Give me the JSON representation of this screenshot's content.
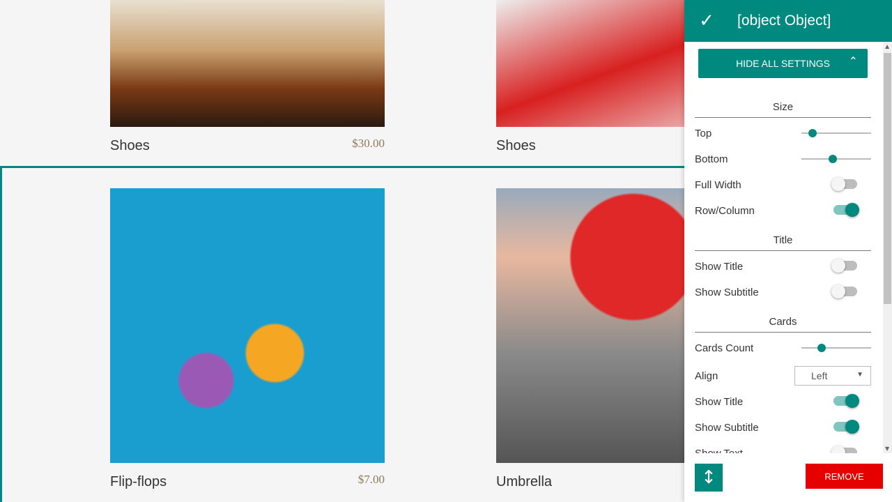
{
  "products_top": [
    {
      "title": "Shoes",
      "price": "$30.00"
    },
    {
      "title": "Shoes",
      "price": ""
    }
  ],
  "products_main": [
    {
      "title": "Flip-flops",
      "price": "$7.00"
    },
    {
      "title": "Umbrella",
      "price": ""
    }
  ],
  "panel": {
    "title": {
      "show_title_label": "Show Title",
      "show_title": false,
      "show_subtitle_label": "Show Subtitle",
      "show_subtitle": false
    },
    "hide_all": "HIDE ALL SETTINGS",
    "groups": {
      "size": "Size",
      "title": "Title",
      "cards": "Cards"
    },
    "size": {
      "top_label": "Top",
      "top_value": 16,
      "bottom_label": "Bottom",
      "bottom_value": 45,
      "full_width_label": "Full Width",
      "full_width": false,
      "row_col_label": "Row/Column",
      "row_col": true
    },
    "cards": {
      "count_label": "Cards Count",
      "count_value": 29,
      "align_label": "Align",
      "align_value": "Left",
      "show_title_label": "Show Title",
      "show_title": true,
      "show_subtitle_label": "Show Subtitle",
      "show_subtitle": true,
      "show_text_label": "Show Text",
      "show_text": false
    },
    "remove": "REMOVE"
  },
  "colors": {
    "accent": "#00897f",
    "danger": "#e60000"
  }
}
